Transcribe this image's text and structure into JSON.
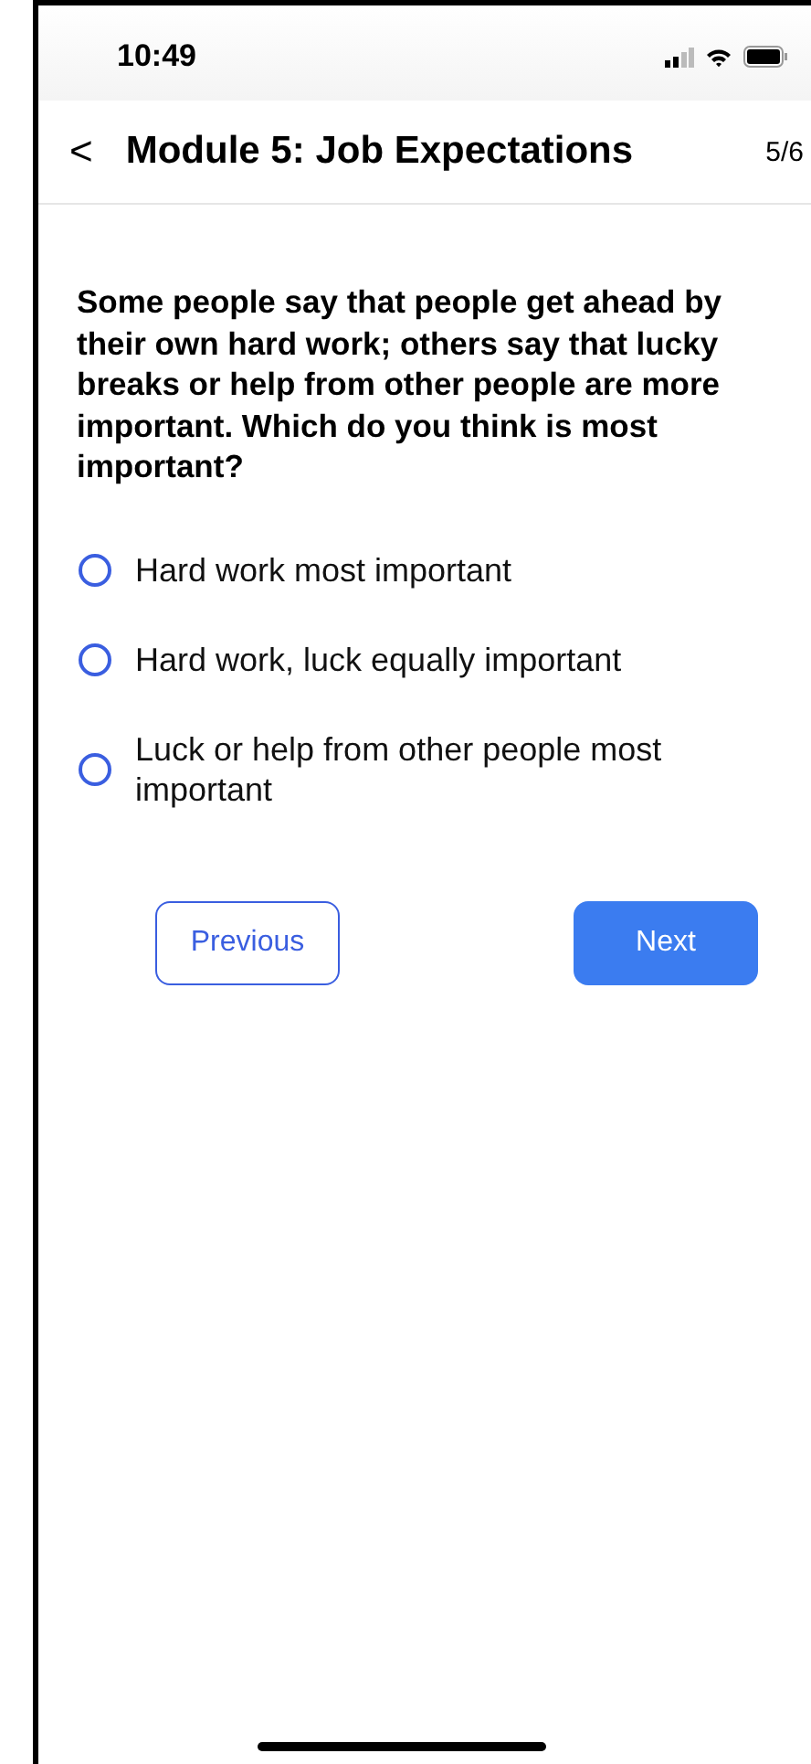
{
  "status_bar": {
    "time": "10:49"
  },
  "header": {
    "back": "<",
    "title": "Module 5: Job Expectations",
    "progress": "5/6"
  },
  "question": "Some people say that people get ahead by their own hard work; others say that lucky breaks or help from other people are more important. Which do you think is most important?",
  "options": [
    {
      "label": "Hard work most important",
      "selected": false
    },
    {
      "label": "Hard work, luck equally important",
      "selected": false
    },
    {
      "label": "Luck or help from other people most important",
      "selected": false
    }
  ],
  "buttons": [
    {
      "label": "Previous",
      "kind": "outline"
    },
    {
      "label": "Next",
      "kind": "filled"
    }
  ]
}
